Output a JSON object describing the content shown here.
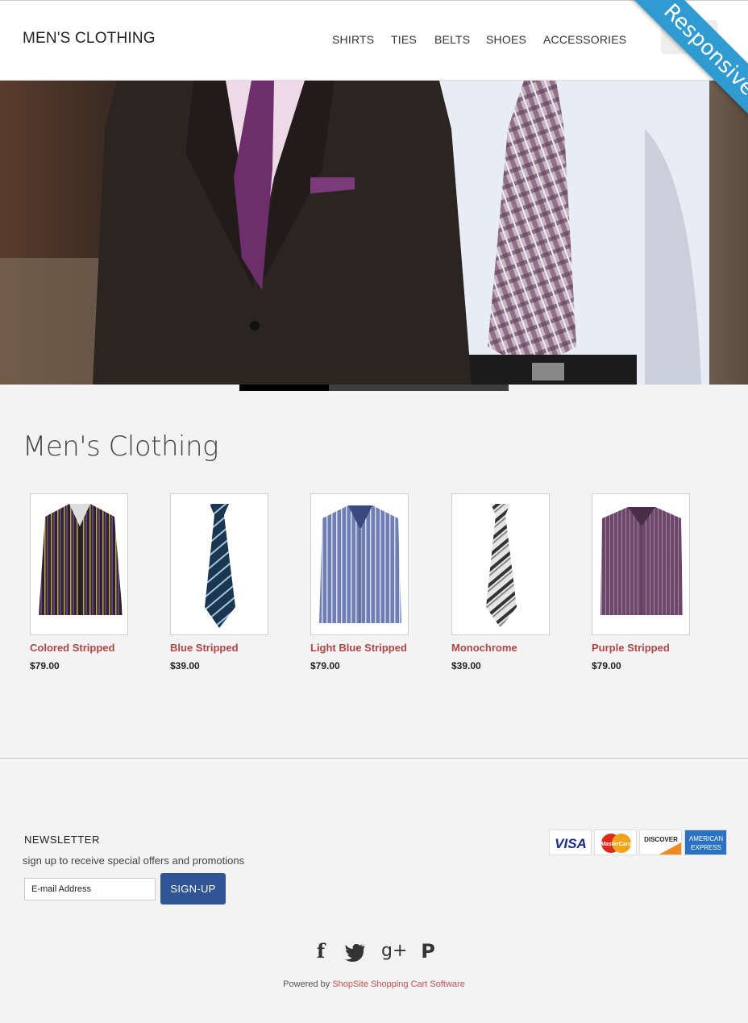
{
  "header": {
    "logo": "MEN'S CLOTHING",
    "nav": [
      "SHIRTS",
      "TIES",
      "BELTS",
      "SHOES",
      "ACCESSORIES"
    ],
    "ribbon": "Responsive"
  },
  "hero": {
    "slider": {
      "slides": 3,
      "active": 1
    }
  },
  "section": {
    "title": "Men's Clothing"
  },
  "products": [
    {
      "name": "Colored Stripped",
      "price": "$79.00",
      "icon": "striped-shirt"
    },
    {
      "name": "Blue Stripped",
      "price": "$39.00",
      "icon": "striped-tie"
    },
    {
      "name": "Light Blue Stripped",
      "price": "$79.00",
      "icon": "striped-shirt"
    },
    {
      "name": "Monochrome",
      "price": "$39.00",
      "icon": "striped-tie"
    },
    {
      "name": "Purple Stripped",
      "price": "$79.00",
      "icon": "striped-shirt"
    }
  ],
  "newsletter": {
    "title": "NEWSLETTER",
    "subtitle": "sign up to receive special offers and promotions",
    "placeholder": "E-mail Address",
    "button": "SIGN-UP"
  },
  "payment_cards": {
    "visa": "VISA",
    "mastercard": "MasterCard",
    "discover": "DISCOVER",
    "amex_line1": "AMERICAN",
    "amex_line2": "EXPRESS"
  },
  "social": {
    "facebook": "f",
    "twitter": "twitter-icon",
    "googleplus": "g+",
    "pinterest": "P"
  },
  "footer": {
    "powered_by": "Powered by",
    "link": "ShopSite Shopping Cart Software"
  },
  "colors": {
    "accent": "#b04545",
    "button": "#2f5594",
    "ribbon": "#2f9bd0"
  }
}
